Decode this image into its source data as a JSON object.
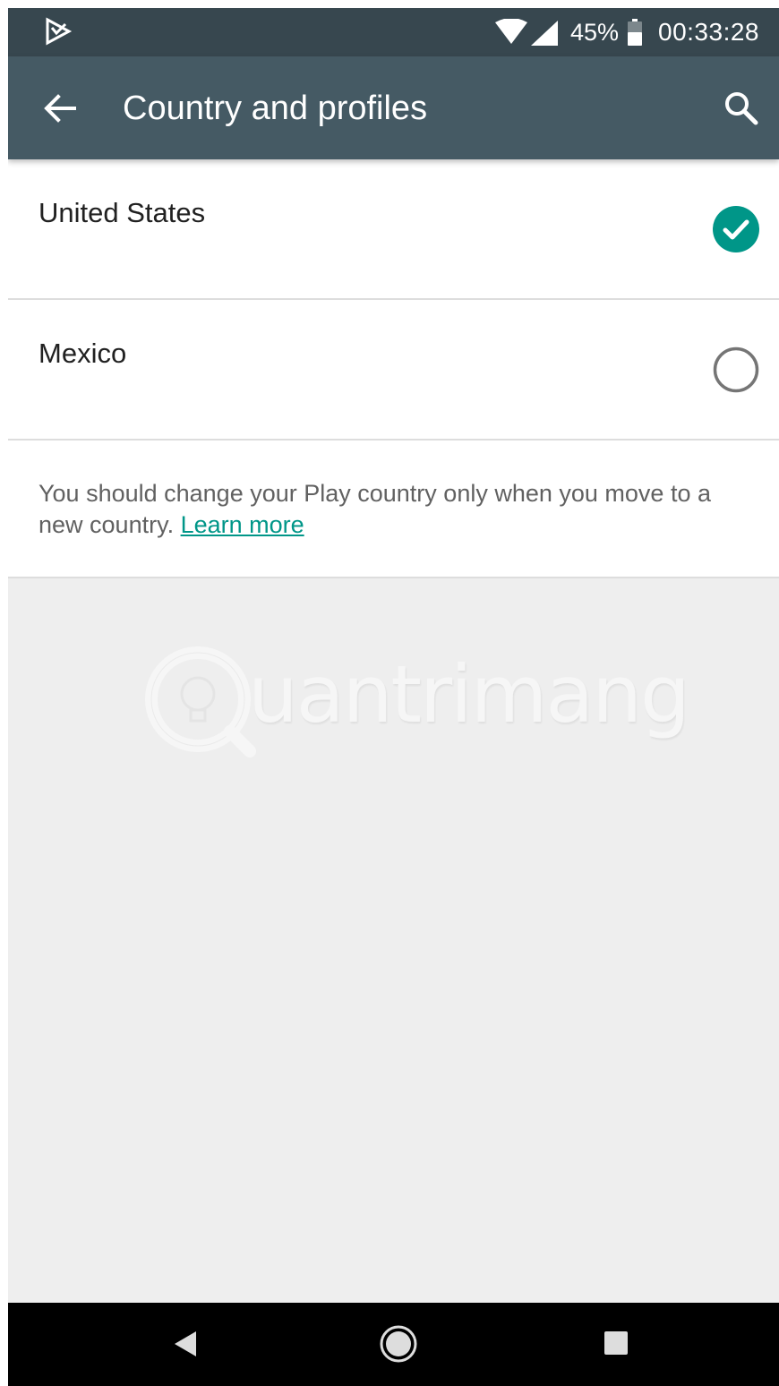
{
  "status_bar": {
    "battery_percent": "45%",
    "time": "00:33:28",
    "icons": [
      "play-store-notification-icon",
      "wifi-icon",
      "cell-signal-icon",
      "battery-icon"
    ]
  },
  "toolbar": {
    "title": "Country and profiles",
    "back_icon": "arrow-back-icon",
    "search_icon": "search-icon"
  },
  "countries": [
    {
      "name": "United States",
      "selected": true
    },
    {
      "name": "Mexico",
      "selected": false
    }
  ],
  "note": {
    "text": "You should change your Play country only when you move to a new country. ",
    "link": "Learn more"
  },
  "watermark": {
    "text": "uantrimang"
  },
  "colors": {
    "status_bar": "#37474f",
    "toolbar": "#455a64",
    "accent": "#009688",
    "background": "#eeeeee"
  }
}
